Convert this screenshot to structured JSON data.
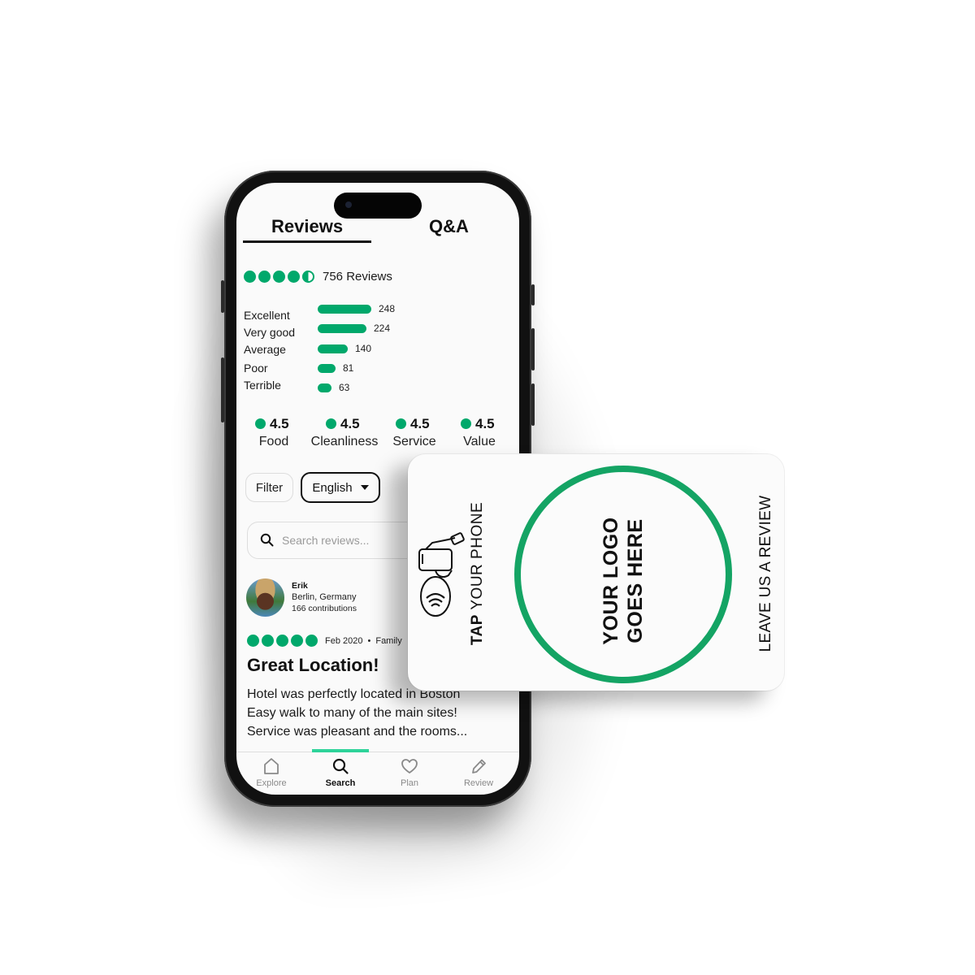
{
  "tabs": [
    {
      "label": "Reviews",
      "active": true
    },
    {
      "label": "Q&A",
      "active": false
    }
  ],
  "overall": {
    "bubbles_filled": 4.5,
    "bubbles_total": 5,
    "review_count_label": "756 Reviews"
  },
  "rating_breakdown": [
    {
      "label": "Excellent",
      "count": 248
    },
    {
      "label": "Very good",
      "count": 224
    },
    {
      "label": "Average",
      "count": 140
    },
    {
      "label": "Poor",
      "count": 81
    },
    {
      "label": "Terrible",
      "count": 63
    }
  ],
  "sub_ratings": [
    {
      "score": "4.5",
      "label": "Food"
    },
    {
      "score": "4.5",
      "label": "Cleanliness"
    },
    {
      "score": "4.5",
      "label": "Service"
    },
    {
      "score": "4.5",
      "label": "Value"
    }
  ],
  "filters": {
    "filter_label": "Filter",
    "language_selected": "English",
    "search_placeholder": "Search reviews..."
  },
  "review": {
    "author": "Erik",
    "location": "Berlin, Germany",
    "contributions": "166 contributions",
    "bubbles": 5,
    "date": "Feb 2020",
    "separator": "•",
    "trip_type": "Family",
    "title": "Great Location!",
    "body_lines": [
      "Hotel was perfectly located in Boston",
      "Easy walk to many of the main sites!",
      "Service was pleasant and the rooms..."
    ]
  },
  "bottom_nav": [
    {
      "label": "Explore",
      "icon": "home-icon",
      "active": false
    },
    {
      "label": "Search",
      "icon": "search-icon",
      "active": true
    },
    {
      "label": "Plan",
      "icon": "heart-icon",
      "active": false
    },
    {
      "label": "Review",
      "icon": "pencil-icon",
      "active": false
    }
  ],
  "nfc_card": {
    "tap_bold": "TAP",
    "tap_rest": " YOUR PHONE",
    "logo_line1": "YOUR LOGO",
    "logo_line2": "GOES HERE",
    "cta": "LEAVE US A REVIEW",
    "icon": "nfc-tap-hand-icon"
  },
  "colors": {
    "brand_green": "#00a86b",
    "card_ring": "#14a464",
    "active_tab_indicator": "#2ed39a"
  }
}
